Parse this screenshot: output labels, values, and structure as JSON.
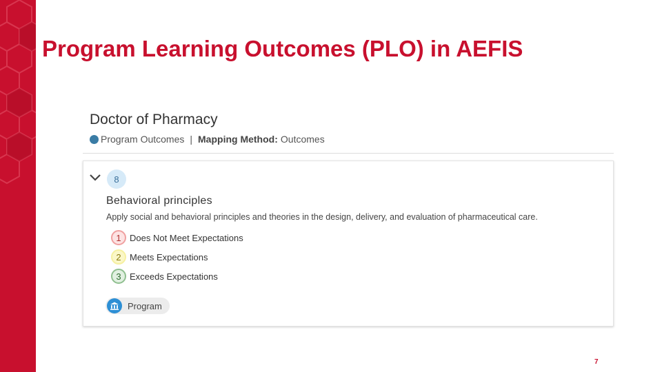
{
  "slide": {
    "title": "Program Learning Outcomes (PLO) in AEFIS",
    "page_number": "7",
    "accent_color": "#c8102e"
  },
  "program": {
    "name": "Doctor of Pharmacy",
    "type": "Program Outcomes",
    "separator": "|",
    "mapping_label": "Mapping Method:",
    "mapping_value": "Outcomes",
    "status_icon": "circle-dot-icon"
  },
  "outcome": {
    "number": "8",
    "title": "Behavioral principles",
    "description": "Apply social and behavioral principles and theories in the design, delivery, and evaluation of pharmaceutical care.",
    "expand_icon": "chevron-down-icon"
  },
  "levels": [
    {
      "num": "1",
      "label": "Does Not Meet Expectations",
      "color": "#f0a0a0"
    },
    {
      "num": "2",
      "label": "Meets Expectations",
      "color": "#f6f0a0"
    },
    {
      "num": "3",
      "label": "Exceeds Expectations",
      "color": "#8fbf8f"
    }
  ],
  "scope": {
    "label": "Program",
    "icon": "institution-icon",
    "icon_color": "#2d8fd5"
  }
}
